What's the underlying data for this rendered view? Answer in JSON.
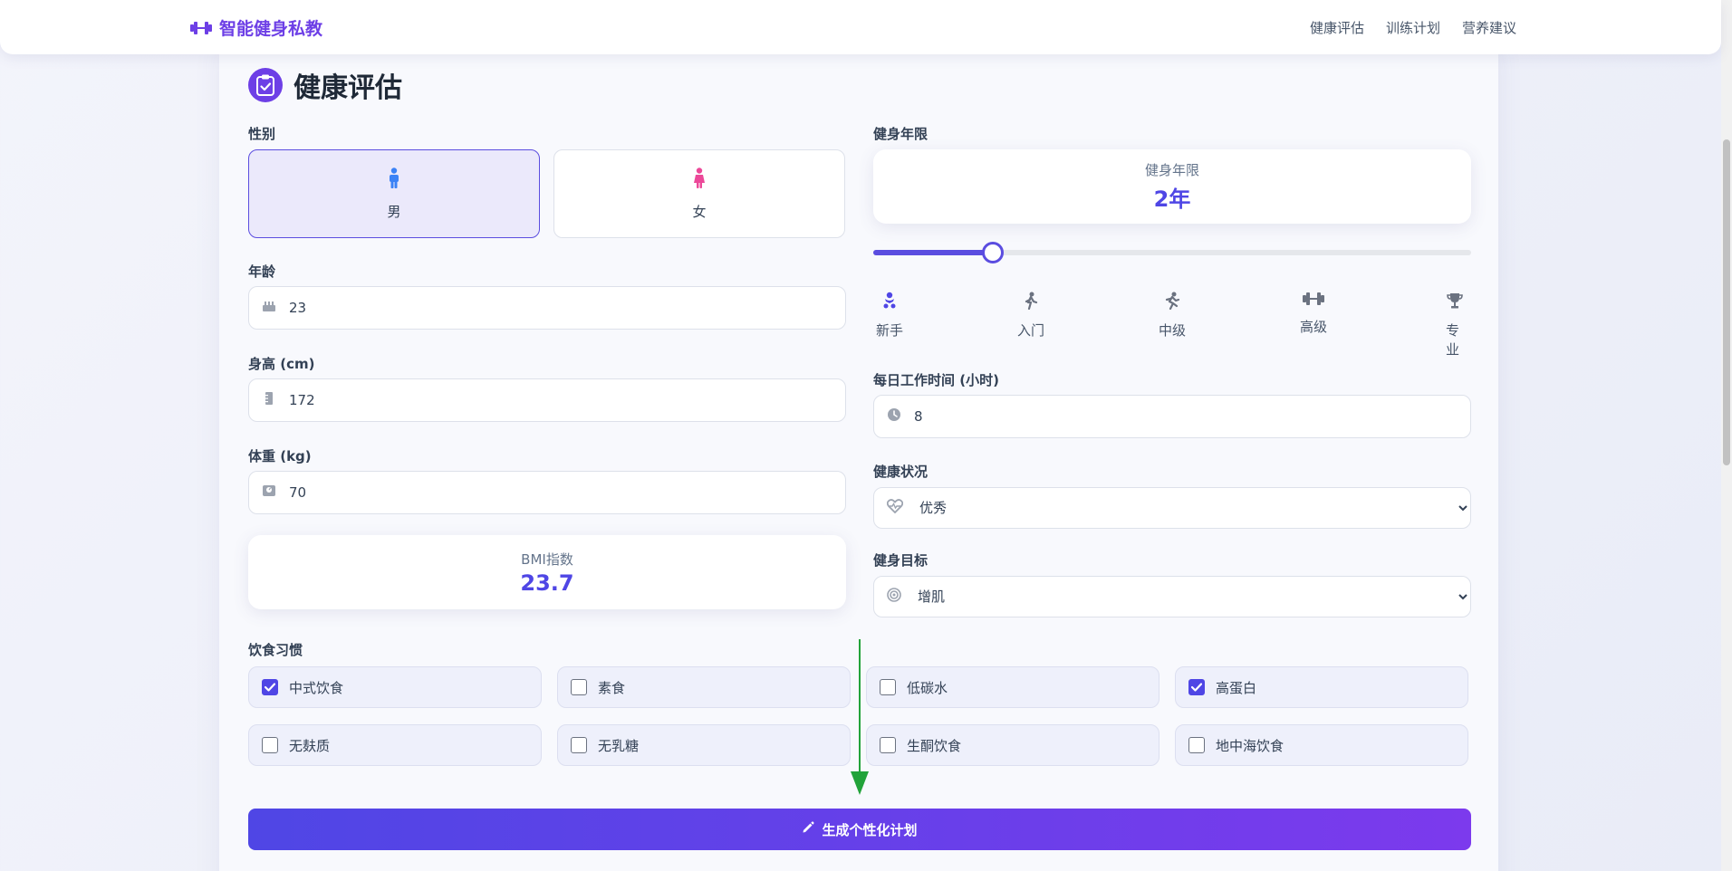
{
  "nav": {
    "brand": "智能健身私教",
    "links": [
      "健康评估",
      "训练计划",
      "营养建议"
    ]
  },
  "assessment": {
    "title": "健康评估",
    "gender": {
      "label": "性别",
      "options": [
        "男",
        "女"
      ],
      "selected": "男"
    },
    "age": {
      "label": "年龄",
      "value": "23"
    },
    "height": {
      "label": "身高 (cm)",
      "value": "172"
    },
    "weight": {
      "label": "体重 (kg)",
      "value": "70"
    },
    "bmi": {
      "label": "BMI指数",
      "value": "23.7"
    },
    "fitness_years": {
      "label": "健身年限",
      "card_label": "健身年限",
      "value": "2年",
      "slider_fraction": 0.2,
      "levels": [
        "新手",
        "入门",
        "中级",
        "高级",
        "专业"
      ]
    },
    "work_hours": {
      "label": "每日工作时间 (小时)",
      "value": "8"
    },
    "health": {
      "label": "健康状况",
      "value": "优秀"
    },
    "goal": {
      "label": "健身目标",
      "value": "增肌"
    },
    "diet": {
      "label": "饮食习惯",
      "items": [
        {
          "label": "中式饮食",
          "checked": true
        },
        {
          "label": "素食",
          "checked": false
        },
        {
          "label": "低碳水",
          "checked": false
        },
        {
          "label": "高蛋白",
          "checked": true
        },
        {
          "label": "无麸质",
          "checked": false
        },
        {
          "label": "无乳糖",
          "checked": false
        },
        {
          "label": "生酮饮食",
          "checked": false
        },
        {
          "label": "地中海饮食",
          "checked": false
        }
      ]
    },
    "generate_label": "生成个性化计划"
  },
  "colors": {
    "accent": "#4f46e5",
    "brand": "#6d3fe6",
    "annotation_arrow": "#22a33a"
  }
}
